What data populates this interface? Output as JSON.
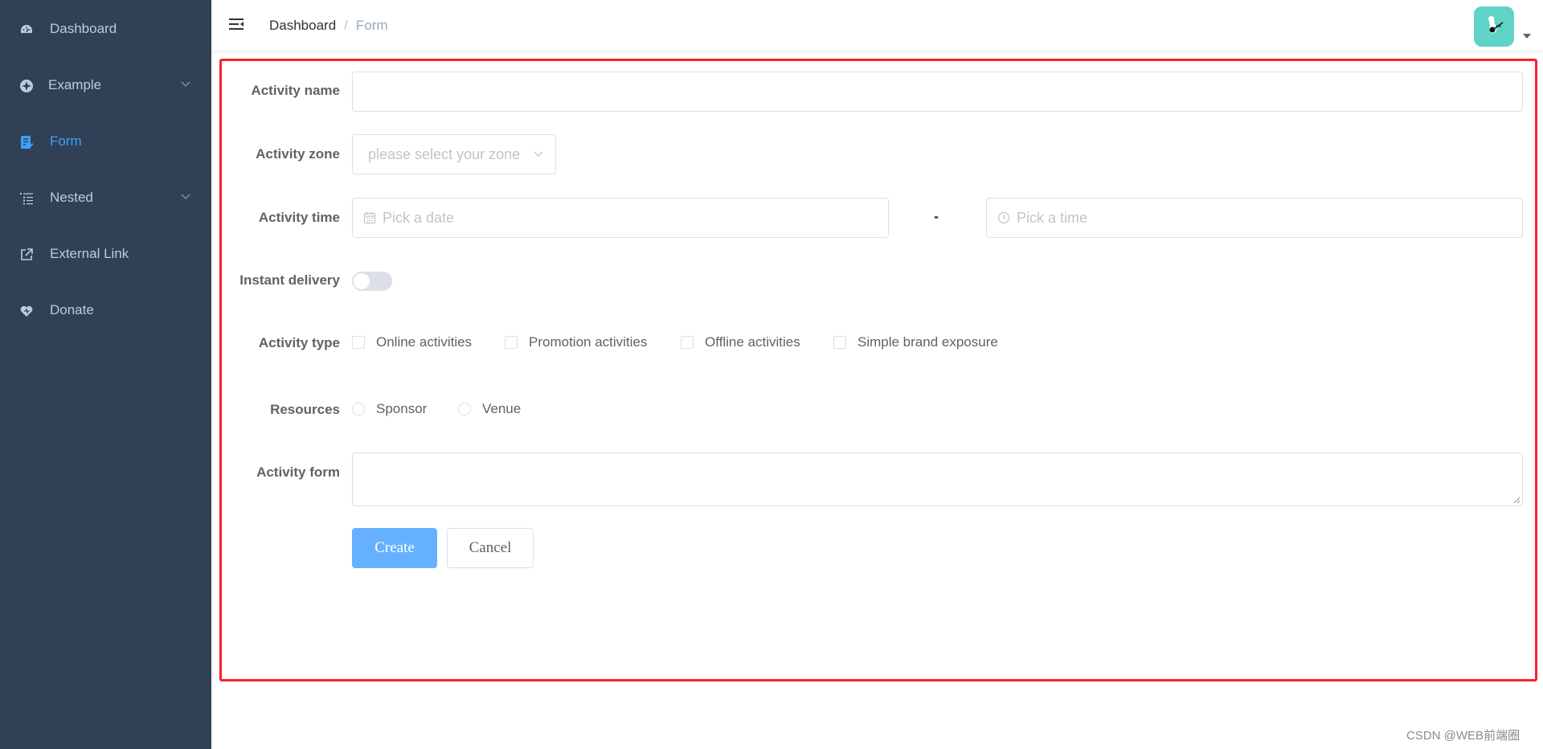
{
  "sidebar": {
    "items": [
      {
        "label": "Dashboard",
        "icon": "dashboard-icon"
      },
      {
        "label": "Example",
        "icon": "example-icon",
        "has_submenu": true
      },
      {
        "label": "Form",
        "icon": "form-icon",
        "active": true
      },
      {
        "label": "Nested",
        "icon": "nested-icon",
        "has_submenu": true
      },
      {
        "label": "External Link",
        "icon": "external-link-icon"
      },
      {
        "label": "Donate",
        "icon": "donate-icon"
      }
    ]
  },
  "navbar": {
    "breadcrumb": [
      "Dashboard",
      "Form"
    ],
    "separator": "/"
  },
  "form": {
    "name_label": "Activity name",
    "name_value": "",
    "zone_label": "Activity zone",
    "zone_placeholder": "please select your zone",
    "time_label": "Activity time",
    "date_placeholder": "Pick a date",
    "time_separator": "-",
    "time_placeholder": "Pick a time",
    "delivery_label": "Instant delivery",
    "delivery_on": false,
    "type_label": "Activity type",
    "type_options": [
      "Online activities",
      "Promotion activities",
      "Offline activities",
      "Simple brand exposure"
    ],
    "resources_label": "Resources",
    "resource_options": [
      "Sponsor",
      "Venue"
    ],
    "desc_label": "Activity form",
    "desc_value": "",
    "create_label": "Create",
    "cancel_label": "Cancel"
  },
  "watermark": "CSDN @WEB前端圈",
  "colors": {
    "sidebar_bg": "#304156",
    "sidebar_text": "#bfcbd9",
    "accent": "#409eff",
    "primary_button": "#66b1ff",
    "highlight_frame": "#f5222d"
  }
}
